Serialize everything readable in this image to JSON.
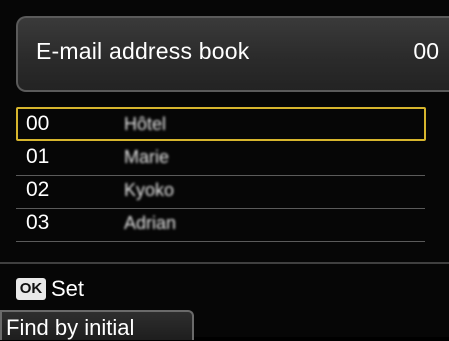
{
  "header": {
    "title": "E-mail address book",
    "count": "00"
  },
  "entries": [
    {
      "num": "00",
      "name": "Hôtel",
      "selected": true
    },
    {
      "num": "01",
      "name": "Marie",
      "selected": false
    },
    {
      "num": "02",
      "name": "Kyoko",
      "selected": false
    },
    {
      "num": "03",
      "name": "Adrian",
      "selected": false
    }
  ],
  "footer": {
    "ok_badge": "OK",
    "ok_label": "Set",
    "find_label": "Find by initial"
  },
  "colors": {
    "selection": "#d6b52d",
    "background": "#060606"
  }
}
